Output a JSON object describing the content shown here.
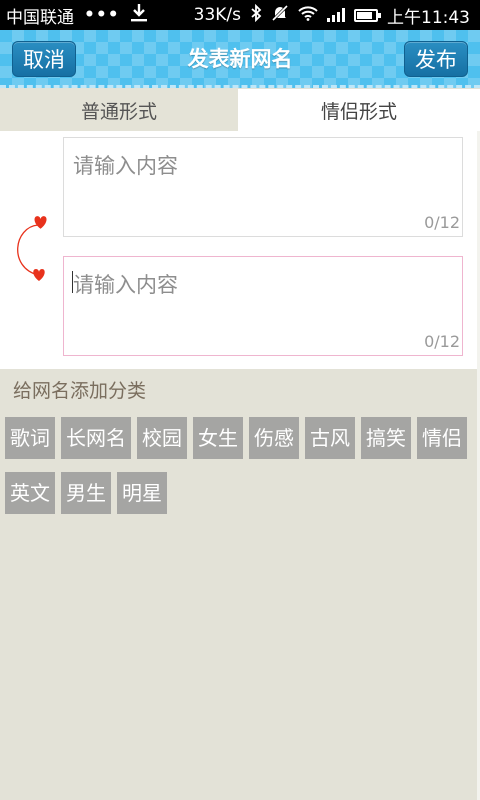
{
  "status_bar": {
    "carrier": "中国联通",
    "dots": "•••",
    "speed": "33K/s",
    "time": "上午11:43",
    "icons": [
      "download-icon",
      "bluetooth-icon",
      "mute-icon",
      "wifi-icon",
      "signal-icon",
      "battery-icon"
    ]
  },
  "header": {
    "cancel_label": "取消",
    "title": "发表新网名",
    "publish_label": "发布"
  },
  "tabs": [
    {
      "label": "普通形式",
      "selected": false
    },
    {
      "label": "情侣形式",
      "selected": true
    }
  ],
  "inputs": [
    {
      "placeholder": "请输入内容",
      "counter": "0/12",
      "focused": false
    },
    {
      "placeholder": "请输入内容",
      "counter": "0/12",
      "focused": true
    }
  ],
  "category": {
    "label": "给网名添加分类",
    "tags": [
      "歌词",
      "长网名",
      "校园",
      "女生",
      "伤感",
      "古风",
      "搞笑",
      "情侣",
      "英文",
      "男生",
      "明星"
    ]
  },
  "colors": {
    "header_blue": "#4fc0ee",
    "button_blue": "#1670a4",
    "heart_red": "#e8321c",
    "tag_gray": "#a5a5a3",
    "background": "#e3e2d7"
  }
}
